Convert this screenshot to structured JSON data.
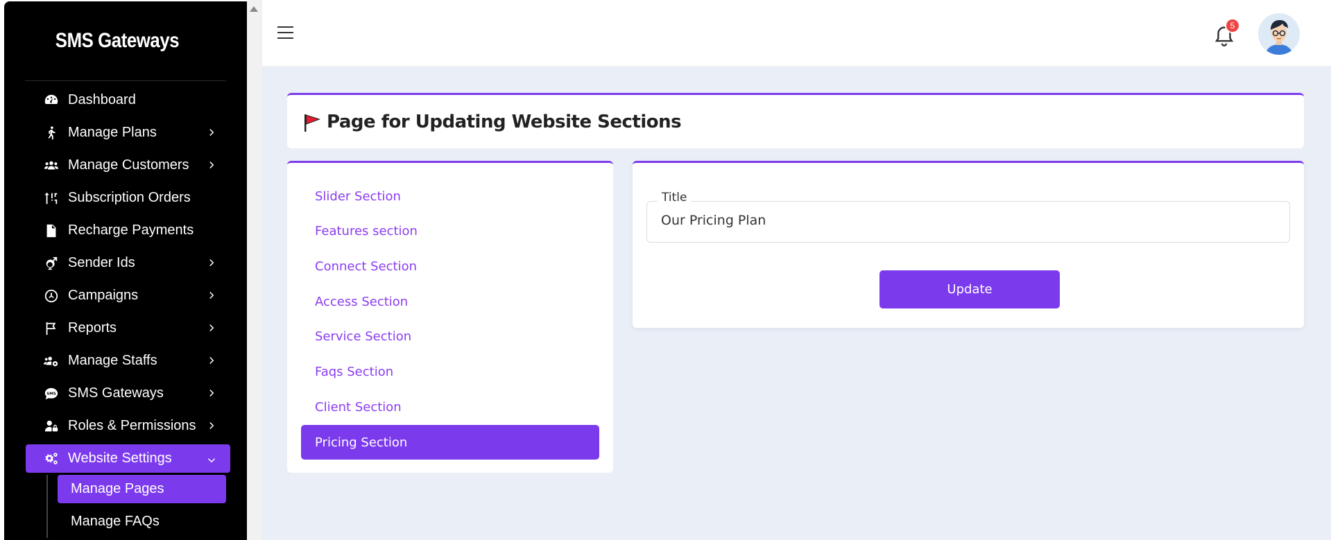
{
  "brand": {
    "name": "SMS Gateways"
  },
  "sidebar": {
    "items": [
      {
        "label": "Dashboard",
        "icon": "dashboard-icon",
        "has_chevron": false
      },
      {
        "label": "Manage Plans",
        "icon": "walking-icon",
        "has_chevron": true
      },
      {
        "label": "Manage Customers",
        "icon": "users-icon",
        "has_chevron": true
      },
      {
        "label": "Subscription Orders",
        "icon": "sort-icon",
        "has_chevron": false
      },
      {
        "label": "Recharge Payments",
        "icon": "invoice-dollar-icon",
        "has_chevron": false
      },
      {
        "label": "Sender Ids",
        "icon": "mars-stroke-icon",
        "has_chevron": true
      },
      {
        "label": "Campaigns",
        "icon": "campaign-icon",
        "has_chevron": true
      },
      {
        "label": "Reports",
        "icon": "flag-outline-icon",
        "has_chevron": true
      },
      {
        "label": "Manage Staffs",
        "icon": "users-cog-icon",
        "has_chevron": true
      },
      {
        "label": "SMS Gateways",
        "icon": "sms-icon",
        "has_chevron": true
      },
      {
        "label": "Roles & Permissions",
        "icon": "user-lock-icon",
        "has_chevron": true
      },
      {
        "label": "Website Settings",
        "icon": "cogs-icon",
        "has_chevron": true,
        "expanded": true,
        "active": true
      }
    ],
    "submenu": [
      {
        "label": "Manage Pages",
        "active": true
      },
      {
        "label": "Manage FAQs",
        "active": false
      }
    ]
  },
  "topbar": {
    "notification_count": "5",
    "menu_icon": "hamburger-icon",
    "bell_icon": "bell-icon"
  },
  "header": {
    "title": "Page for Updating Website Sections",
    "icon": "red-flag-icon"
  },
  "sections": {
    "items": [
      {
        "label": "Slider Section",
        "active": false
      },
      {
        "label": "Features section",
        "active": false
      },
      {
        "label": "Connect Section",
        "active": false
      },
      {
        "label": "Access Section",
        "active": false
      },
      {
        "label": "Service Section",
        "active": false
      },
      {
        "label": "Faqs Section",
        "active": false
      },
      {
        "label": "Client Section",
        "active": false
      },
      {
        "label": "Pricing Section",
        "active": true
      }
    ]
  },
  "form": {
    "title_label": "Title",
    "title_value": "Our Pricing Plan",
    "update_label": "Update"
  },
  "colors": {
    "accent": "#7c3aed",
    "sidebar_bg": "#000000",
    "main_bg": "#e9eef7",
    "badge": "#ef4444"
  }
}
